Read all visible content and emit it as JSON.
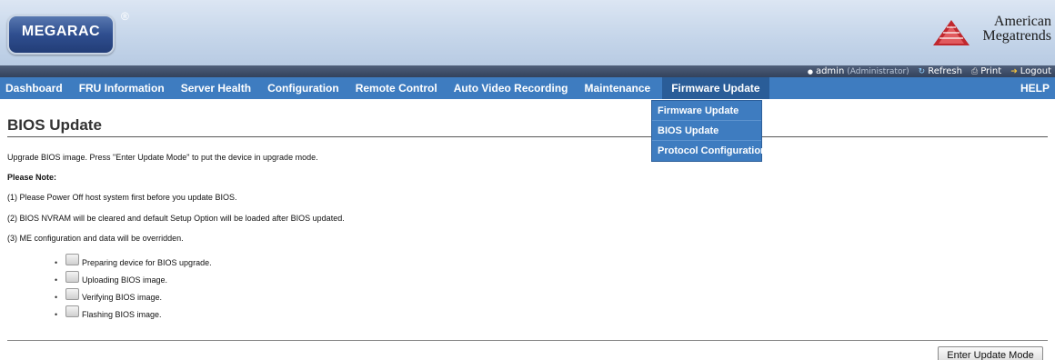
{
  "header": {
    "logo_text": "MEGARAC",
    "logo_reg": "®",
    "brand_line1": "American",
    "brand_line2": "Megatrends"
  },
  "user_bar": {
    "user": "admin",
    "role": "(Administrator)",
    "refresh_label": "Refresh",
    "print_label": "Print",
    "logout_label": "Logout"
  },
  "nav": {
    "items": [
      {
        "label": "Dashboard"
      },
      {
        "label": "FRU Information"
      },
      {
        "label": "Server Health"
      },
      {
        "label": "Configuration"
      },
      {
        "label": "Remote Control"
      },
      {
        "label": "Auto Video Recording"
      },
      {
        "label": "Maintenance"
      },
      {
        "label": "Firmware Update"
      }
    ],
    "help_label": "HELP"
  },
  "dropdown": {
    "items": [
      {
        "label": "Firmware Update"
      },
      {
        "label": "BIOS Update"
      },
      {
        "label": "Protocol Configuration"
      }
    ]
  },
  "content": {
    "title": "BIOS Update",
    "intro": "Upgrade BIOS image. Press \"Enter Update Mode\" to put the device in upgrade mode.",
    "note_heading": "Please Note:",
    "notes": [
      "(1) Please Power Off host system first before you update BIOS.",
      "(2) BIOS NVRAM will be cleared and default Setup Option will be loaded after BIOS updated.",
      "(3) ME configuration and data will be overridden."
    ],
    "steps": [
      "Preparing device for BIOS upgrade.",
      "Uploading BIOS image.",
      "Verifying BIOS image.",
      "Flashing BIOS image."
    ],
    "button_label": "Enter Update Mode"
  },
  "colors": {
    "nav_bg": "#3e7cc0",
    "nav_active": "#2a5d98",
    "logo_blue": "#2f4e8f",
    "brand_red": "#c0282e"
  }
}
